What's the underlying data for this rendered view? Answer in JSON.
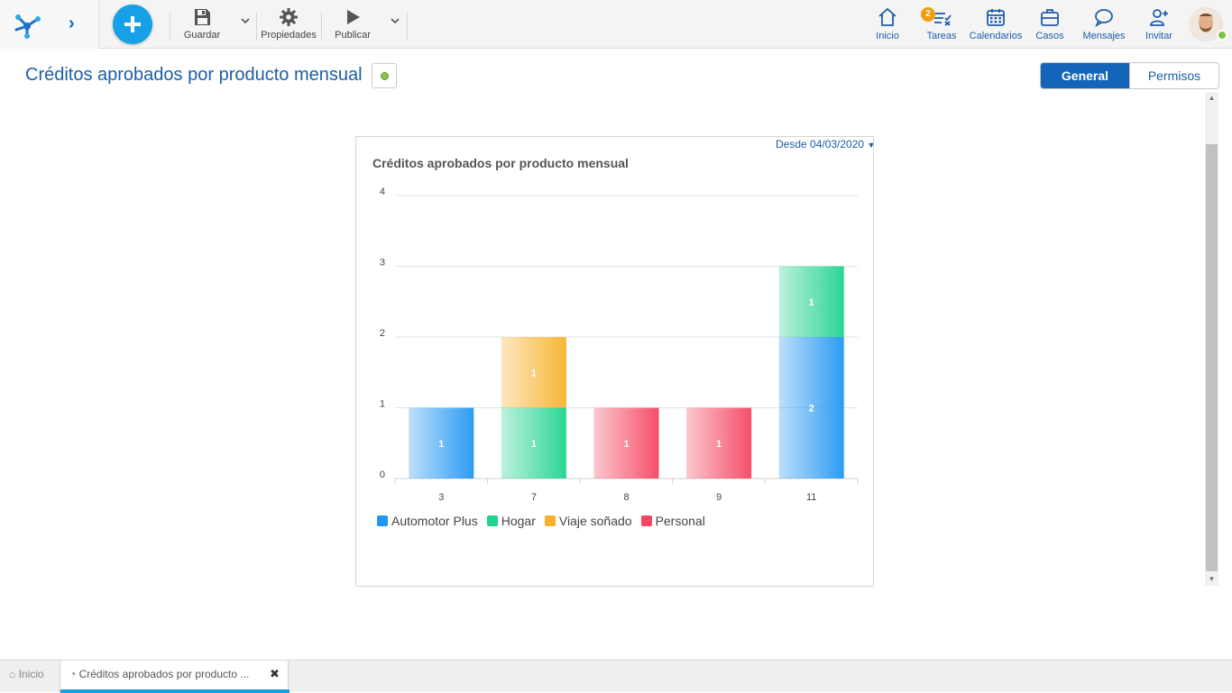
{
  "toolbar": {
    "save_label": "Guardar",
    "properties_label": "Propiedades",
    "publish_label": "Publicar"
  },
  "nav": {
    "home_label": "Inicio",
    "tasks_label": "Tareas",
    "tasks_badge": "2",
    "calendars_label": "Calendarios",
    "cases_label": "Casos",
    "messages_label": "Mensajes",
    "invite_label": "Invitar"
  },
  "page": {
    "title": "Créditos aprobados por producto mensual",
    "status_color": "#8bc34a"
  },
  "tabs": {
    "general": "General",
    "permissions": "Permisos"
  },
  "chart_card": {
    "date_filter": "Desde 04/03/2020"
  },
  "chart_data": {
    "type": "bar",
    "stacked": true,
    "title": "Créditos aprobados por producto mensual",
    "categories": [
      "3",
      "7",
      "8",
      "9",
      "11"
    ],
    "y_ticks": [
      "0",
      "1",
      "2",
      "3",
      "4"
    ],
    "ylim": [
      0,
      4
    ],
    "grid": true,
    "legend_position": "bottom-left",
    "series": [
      {
        "name": "Automotor Plus",
        "color": "#2196f3",
        "values": [
          1,
          0,
          0,
          0,
          2
        ]
      },
      {
        "name": "Hogar",
        "color": "#1fd38f",
        "values": [
          0,
          1,
          0,
          0,
          1
        ]
      },
      {
        "name": "Viaje soñado",
        "color": "#f7b22c",
        "values": [
          0,
          1,
          0,
          0,
          0
        ]
      },
      {
        "name": "Personal",
        "color": "#f4465f",
        "values": [
          0,
          0,
          1,
          1,
          0
        ]
      }
    ]
  },
  "bottom_tabs": {
    "home": "Inicio",
    "chart_tab": "Créditos aprobados por producto ..."
  }
}
